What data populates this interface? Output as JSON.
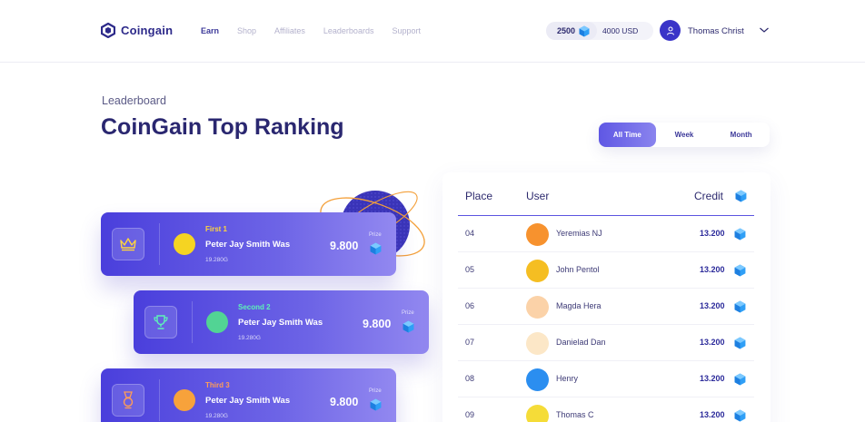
{
  "header": {
    "logo_text": "Coingain",
    "nav": [
      {
        "label": "Earn",
        "active": true
      },
      {
        "label": "Shop",
        "active": false
      },
      {
        "label": "Affiliates",
        "active": false
      },
      {
        "label": "Leaderboards",
        "active": false
      },
      {
        "label": "Support",
        "active": false
      }
    ],
    "balance_credits": "2500",
    "balance_usd": "4000 USD",
    "user_name": "Thomas Christ"
  },
  "hero": {
    "eyebrow": "Leaderboard",
    "title": "CoinGain Top Ranking"
  },
  "filter": {
    "options": [
      "All Time",
      "Week",
      "Month"
    ],
    "selected": "All Time"
  },
  "podium": [
    {
      "rank_label": "First 1",
      "rank_color": "#ffd53d",
      "badge_icon": "crown-icon",
      "avatar_color": "#f5d422",
      "name": "Peter Jay Smith Was",
      "points": "19.280G",
      "value": "9.800",
      "prize_label": "Prize"
    },
    {
      "rank_label": "Second 2",
      "rank_color": "#5ef2b8",
      "badge_icon": "trophy-icon",
      "avatar_color": "#52d494",
      "name": "Peter Jay Smith Was",
      "points": "19.280G",
      "value": "9.800",
      "prize_label": "Prize"
    },
    {
      "rank_label": "Third 3",
      "rank_color": "#ff9d57",
      "badge_icon": "medal-icon",
      "avatar_color": "#f7a23b",
      "name": "Peter Jay Smith Was",
      "points": "19.280G",
      "value": "9.800",
      "prize_label": "Prize"
    }
  ],
  "table": {
    "headers": {
      "place": "Place",
      "user": "User",
      "credit": "Credit"
    },
    "rows": [
      {
        "place": "04",
        "user": "Yeremias NJ",
        "credit": "13.200",
        "avatar_color": "#f7922e"
      },
      {
        "place": "05",
        "user": "John Pentol",
        "credit": "13.200",
        "avatar_color": "#f5be22"
      },
      {
        "place": "06",
        "user": "Magda Hera",
        "credit": "13.200",
        "avatar_color": "#fbd2a8"
      },
      {
        "place": "07",
        "user": "Danielad Dan",
        "credit": "13.200",
        "avatar_color": "#fce7c7"
      },
      {
        "place": "08",
        "user": "Henry",
        "credit": "13.200",
        "avatar_color": "#2b8ef0"
      },
      {
        "place": "09",
        "user": "Thomas C",
        "credit": "13.200",
        "avatar_color": "#f5dc38"
      }
    ]
  },
  "colors": {
    "accent": "#3a34c8",
    "gem": "#2f9ff6",
    "title": "#2a2770"
  }
}
